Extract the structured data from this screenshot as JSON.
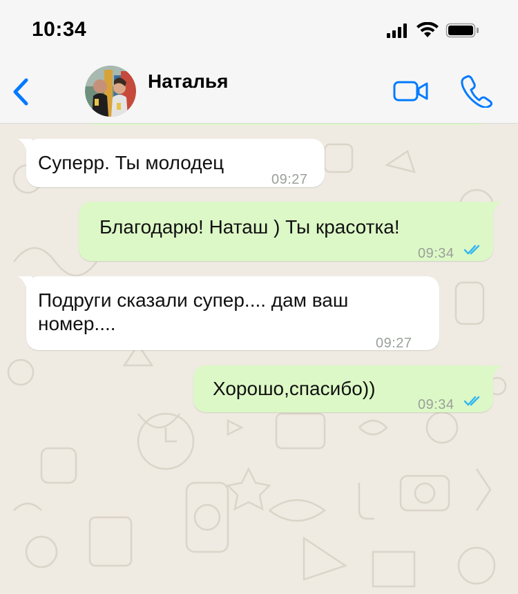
{
  "status_bar": {
    "time": "10:34",
    "icons": [
      "cellular-signal-icon",
      "wifi-icon",
      "battery-icon"
    ]
  },
  "header": {
    "back_icon": "chevron-left-icon",
    "contact_name": "Наталья",
    "actions": [
      "video-call-icon",
      "phone-call-icon"
    ],
    "accent_color": "#007aff"
  },
  "messages": [
    {
      "direction": "in",
      "text": "Суперр. Ты молодец",
      "time": "09:27"
    },
    {
      "direction": "out",
      "text": "Благодарю! Наташ ) Ты красотка!",
      "time": "09:34",
      "status": "read"
    },
    {
      "direction": "in",
      "text": "Подруги сказали супер.... дам ваш\nномер....",
      "time": "09:27"
    },
    {
      "direction": "out",
      "text": "Хорошо,спасибо))",
      "time": "09:34",
      "status": "read"
    }
  ],
  "colors": {
    "incoming_bubble": "#ffffff",
    "outgoing_bubble": "#dcf8c6",
    "chat_background": "#efeae2",
    "read_ticks": "#34b7f1"
  }
}
